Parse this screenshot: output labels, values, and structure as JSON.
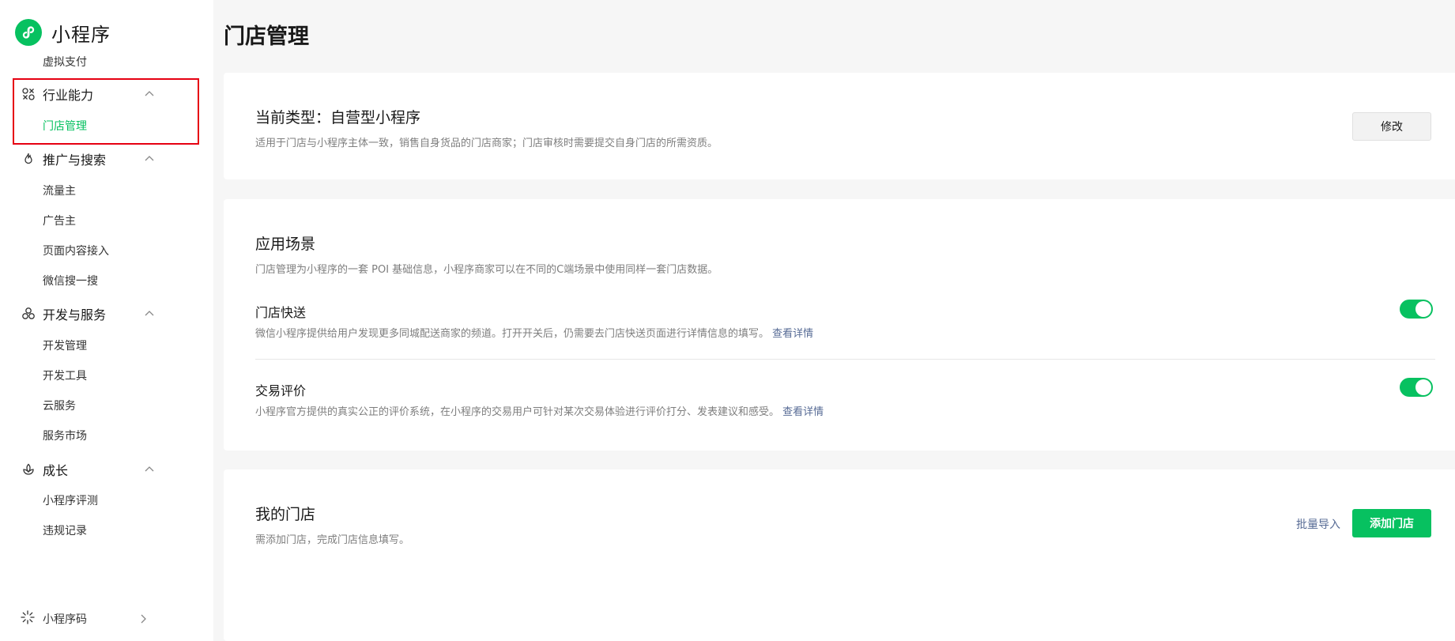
{
  "brand": {
    "name": "小程序"
  },
  "sidebar": {
    "cut_item": "虚拟支付",
    "groups": [
      {
        "label": "行业能力",
        "items": [
          "门店管理"
        ]
      },
      {
        "label": "推广与搜索",
        "items": [
          "流量主",
          "广告主",
          "页面内容接入",
          "微信搜一搜"
        ]
      },
      {
        "label": "开发与服务",
        "items": [
          "开发管理",
          "开发工具",
          "云服务",
          "服务市场"
        ]
      },
      {
        "label": "成长",
        "items": [
          "小程序评测",
          "违规记录"
        ]
      }
    ],
    "qr_label": "小程序码"
  },
  "page": {
    "title": "门店管理"
  },
  "type_card": {
    "title": "当前类型：自营型小程序",
    "desc": "适用于门店与小程序主体一致，销售自身货品的门店商家；门店审核时需要提交自身门店的所需资质。",
    "modify_label": "修改"
  },
  "scene_card": {
    "title": "应用场景",
    "desc": "门店管理为小程序的一套 POI 基础信息，小程序商家可以在不同的C端场景中使用同样一套门店数据。",
    "features": [
      {
        "title": "门店快送",
        "desc": "微信小程序提供给用户发现更多同城配送商家的频道。打开开关后，仍需要去门店快送页面进行详情信息的填写。",
        "link": "查看详情",
        "enabled": true
      },
      {
        "title": "交易评价",
        "desc": "小程序官方提供的真实公正的评价系统，在小程序的交易用户可针对某次交易体验进行评价打分、发表建议和感受。",
        "link": "查看详情",
        "enabled": true
      }
    ]
  },
  "stores_card": {
    "title": "我的门店",
    "desc": "需添加门店，完成门店信息填写。",
    "batch_import_label": "批量导入",
    "add_store_label": "添加门店"
  },
  "colors": {
    "accent": "#07c160",
    "link": "#576b95",
    "highlight": "#e60012"
  }
}
